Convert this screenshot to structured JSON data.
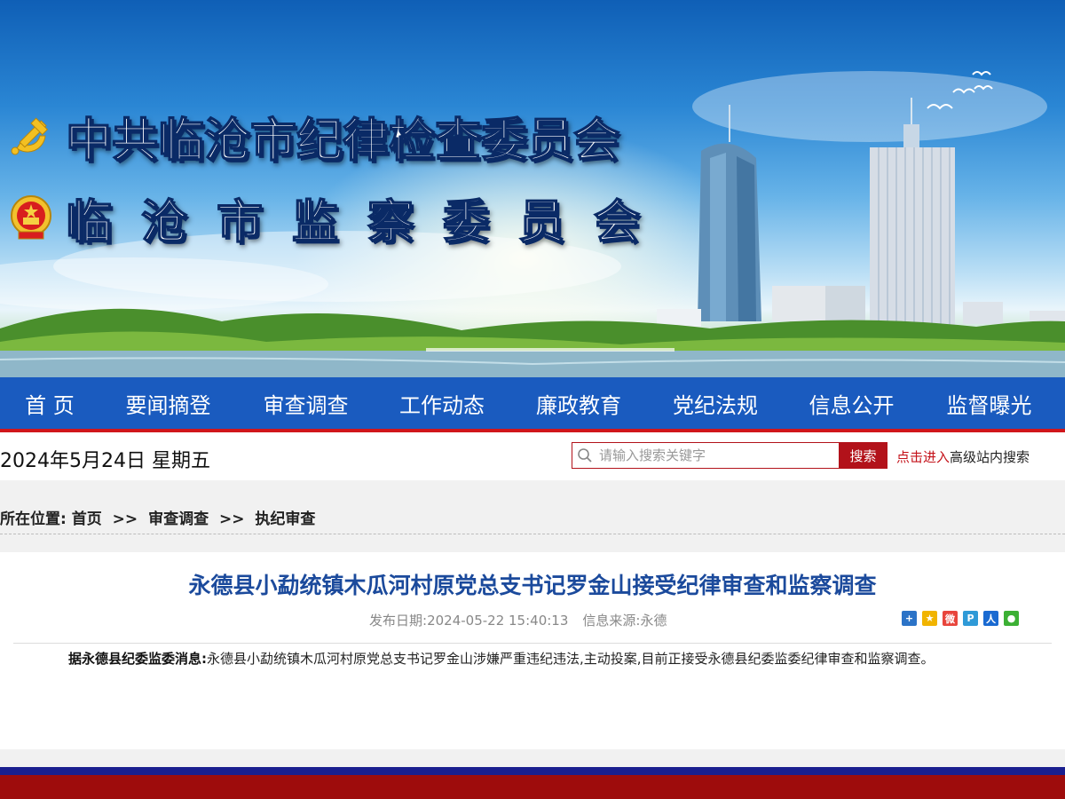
{
  "banner": {
    "title_line1": "中共临沧市纪律检查委员会",
    "title_line2": "临沧市监察委员会",
    "party_emblem_icon": "hammer-sickle-icon",
    "state_emblem_icon": "national-emblem-icon"
  },
  "nav": {
    "items": [
      {
        "label": "首 页"
      },
      {
        "label": "要闻摘登"
      },
      {
        "label": "审查调查"
      },
      {
        "label": "工作动态"
      },
      {
        "label": "廉政教育"
      },
      {
        "label": "党纪法规"
      },
      {
        "label": "信息公开"
      },
      {
        "label": "监督曝光"
      }
    ]
  },
  "datebar": {
    "date": "2024年5月24日 星期五",
    "search_placeholder": "请输入搜索关键字",
    "search_button": "搜索",
    "advanced_link_red": "点击进入",
    "advanced_link_dark": "高级站内搜索"
  },
  "breadcrumb": {
    "label": "所在位置:",
    "items": [
      "首页",
      "审查调查",
      "执纪审查"
    ],
    "separator": ">>"
  },
  "article": {
    "title": "永德县小勐统镇木瓜河村原党总支书记罗金山接受纪律审查和监察调查",
    "date_label": "发布日期:",
    "date": "2024-05-22 15:40:13",
    "source_label": "信息来源:",
    "source": "永德",
    "lead": "据永德县纪委监委消息:",
    "body": "永德县小勐统镇木瓜河村原党总支书记罗金山涉嫌严重违纪违法,主动投案,目前正接受永德县纪委监委纪律审查和监察调查。"
  },
  "share_icons": [
    "share-more-icon",
    "qzone-icon",
    "weibo-icon",
    "pengyou-icon",
    "renren-icon",
    "wechat-icon"
  ],
  "colors": {
    "nav_blue": "#1a5bbf",
    "accent_red": "#b2121a",
    "title_blue": "#1b4a9c",
    "footer_blue": "#1a1f8f",
    "footer_red": "#9e0c0c"
  }
}
